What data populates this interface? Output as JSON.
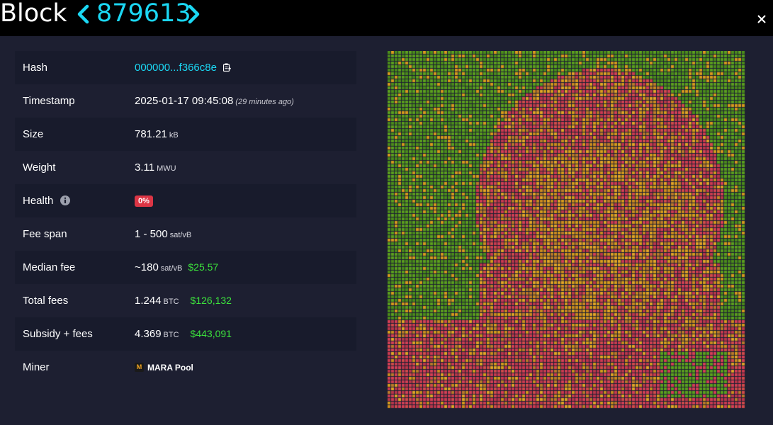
{
  "header": {
    "title": "Block",
    "block_number": "879613"
  },
  "details": {
    "hash": {
      "label": "Hash",
      "value": "000000...f366c8e"
    },
    "timestamp": {
      "label": "Timestamp",
      "value": "2025-01-17 09:45:08",
      "ago": "(29 minutes ago)"
    },
    "size": {
      "label": "Size",
      "value": "781.21",
      "unit": "kB"
    },
    "weight": {
      "label": "Weight",
      "value": "3.11",
      "unit": "MWU"
    },
    "health": {
      "label": "Health",
      "value": "0%"
    },
    "fee_span": {
      "label": "Fee span",
      "value": "1 - 500",
      "unit": "sat/vB"
    },
    "median_fee": {
      "label": "Median fee",
      "value": "~180",
      "unit": "sat/vB",
      "usd": "$25.57"
    },
    "total_fees": {
      "label": "Total fees",
      "value": "1.244",
      "unit": "BTC",
      "usd": "$126,132"
    },
    "subsidy_fees": {
      "label": "Subsidy + fees",
      "value": "4.369",
      "unit": "BTC",
      "usd": "$443,091"
    },
    "miner": {
      "label": "Miner",
      "logo_letter": "M",
      "value": "MARA Pool"
    }
  },
  "icons": {
    "prev": "chevron-left-icon",
    "next": "chevron-right-icon",
    "close": "close-icon",
    "copy": "clipboard-icon",
    "info": "info-circle-icon",
    "miner_logo": "mara-logo-icon"
  },
  "colors": {
    "accent": "#1bd8f4",
    "usd": "#3ce23c",
    "health_badge": "#dc3545",
    "fee_low": "#5a9e1e",
    "fee_mid": "#d49a1c",
    "fee_high": "#d23f55"
  }
}
